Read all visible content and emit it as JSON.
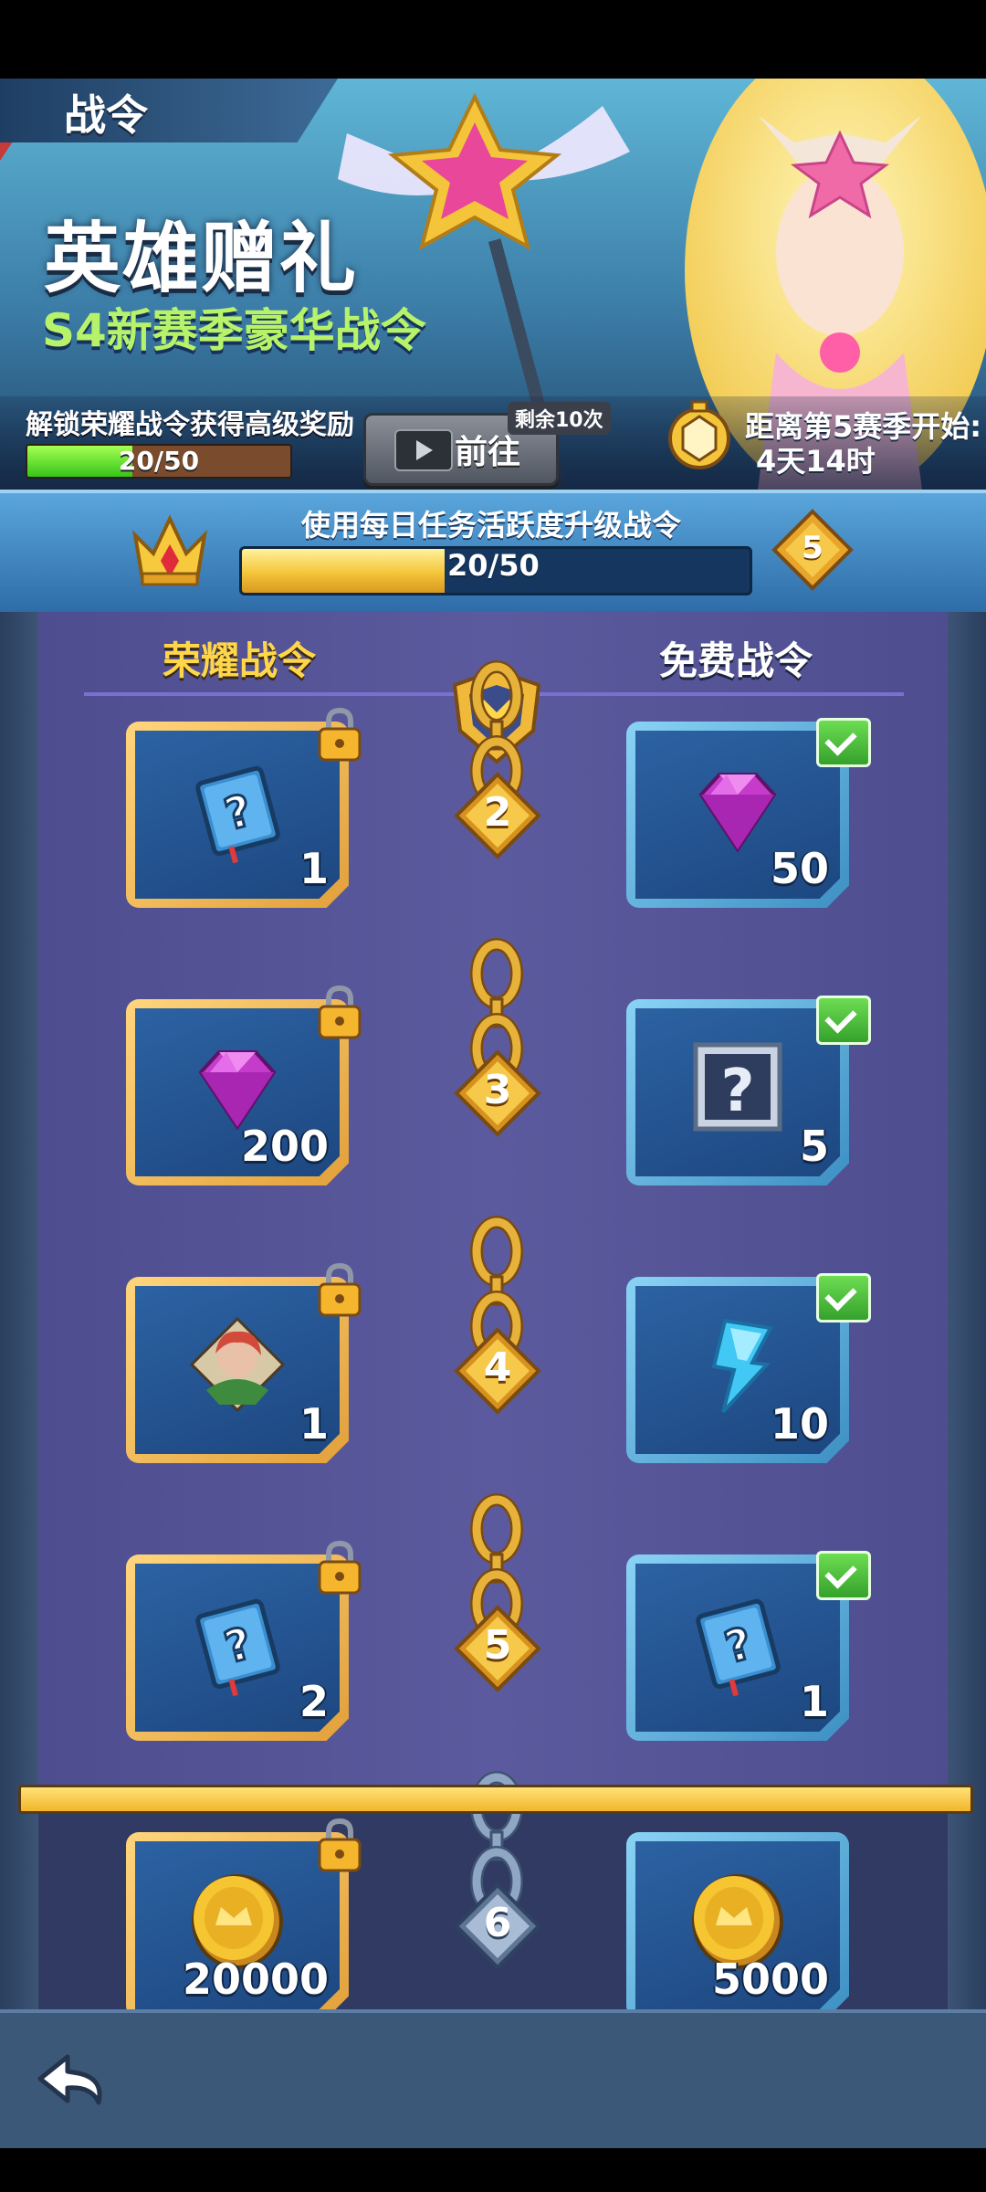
{
  "header": {
    "title": "战令"
  },
  "banner": {
    "hero_title": "英雄赠礼",
    "hero_subtitle": "S4新赛季豪华战令",
    "unlock_text": "解锁荣耀战令获得高级奖励",
    "unlock_progress_text": "20/50",
    "unlock_progress": 0.4,
    "goto_button": "前往",
    "goto_remaining": "剩余10次",
    "season_line1": "距离第5赛季开始:",
    "season_line2": "4天14时"
  },
  "progress": {
    "text": "使用每日任务活跃度升级战令",
    "value_text": "20/50",
    "fraction": 0.4,
    "level": "5"
  },
  "columns": {
    "glory": "荣耀战令",
    "free": "免费战令"
  },
  "rows": [
    {
      "level": "2",
      "glory": {
        "icon": "skill-book-icon",
        "qty": "1",
        "locked": true
      },
      "free": {
        "icon": "gem-icon",
        "qty": "50",
        "claimed": true
      }
    },
    {
      "level": "3",
      "glory": {
        "icon": "gem-icon",
        "qty": "200",
        "locked": true
      },
      "free": {
        "icon": "mystery-card-icon",
        "qty": "5",
        "claimed": true
      }
    },
    {
      "level": "4",
      "glory": {
        "icon": "hero-fragment-icon",
        "qty": "1",
        "locked": true
      },
      "free": {
        "icon": "energy-bolt-icon",
        "qty": "10",
        "claimed": true
      }
    },
    {
      "level": "5",
      "glory": {
        "icon": "skill-book-icon",
        "qty": "2",
        "locked": true
      },
      "free": {
        "icon": "skill-book-icon",
        "qty": "1",
        "claimed": true
      }
    },
    {
      "level": "6",
      "glory": {
        "icon": "gold-coin-icon",
        "qty": "20000",
        "locked": true
      },
      "free": {
        "icon": "gold-coin-icon",
        "qty": "5000",
        "claimed": false
      }
    }
  ],
  "colors": {
    "accent_gold": "#f4c53a",
    "banner_green": "#b7f36a",
    "panel_purple": "#5c5a9e"
  }
}
